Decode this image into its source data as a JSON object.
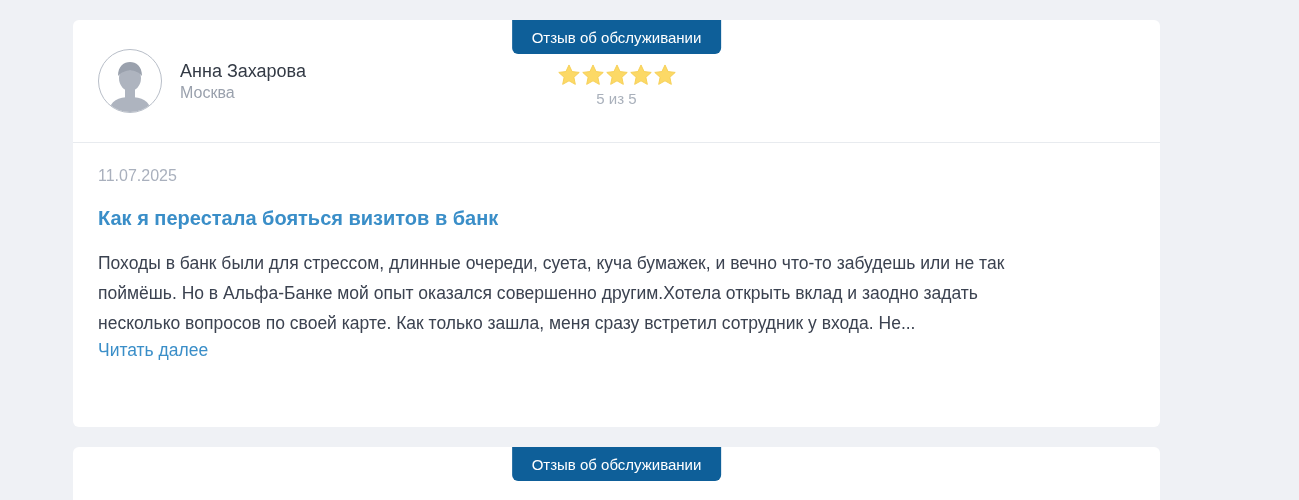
{
  "reviews": [
    {
      "badge": "Отзыв об обслуживании",
      "author": "Анна Захарова",
      "city": "Москва",
      "stars": 5,
      "rating_text": "5 из 5",
      "date": "11.07.2025",
      "title": "Как я перестала бояться визитов в банк",
      "text": "Походы в банк были для стрессом, длинные очереди, суета, куча бумажек, и вечно что-то забудешь или не так поймёшь. Но в Альфа-Банке мой опыт оказался совершенно другим.Хотела открыть вклад и заодно задать несколько вопросов по своей карте. Как только зашла, меня сразу встретил сотрудник у входа. Не...",
      "read_more": "Читать далее"
    },
    {
      "badge": "Отзыв об обслуживании"
    }
  ]
}
